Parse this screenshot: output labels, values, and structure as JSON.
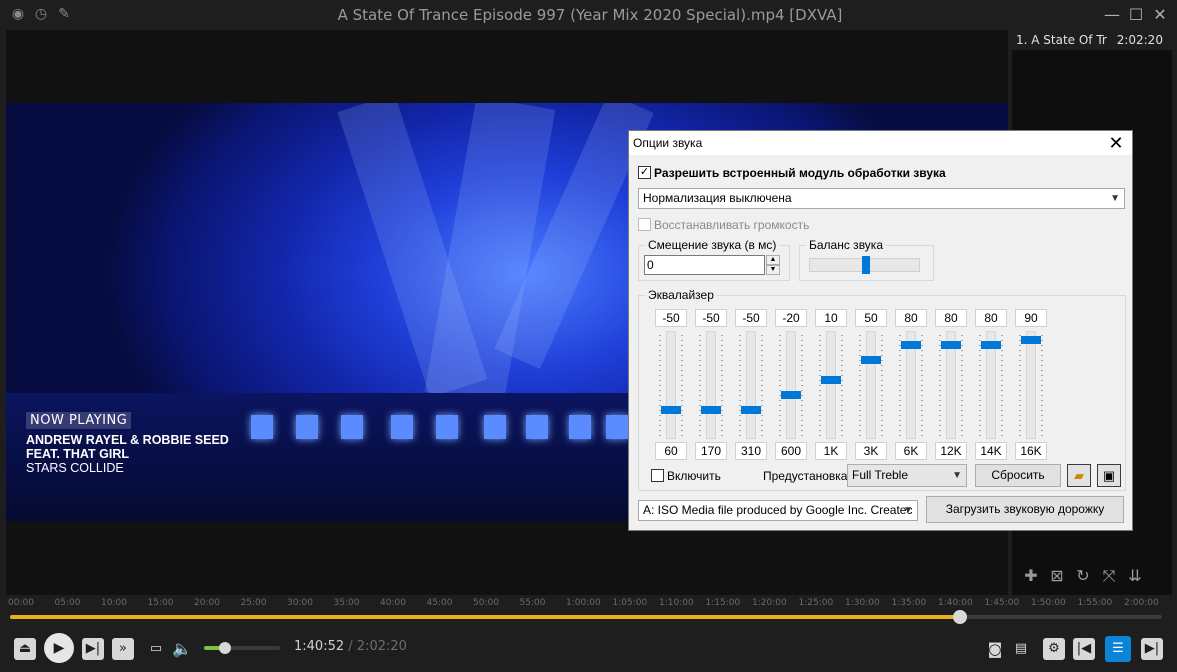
{
  "window": {
    "title": "A State Of Trance Episode 997 (Year Mix 2020 Special).mp4 [DXVA]",
    "left_icons": [
      "menu-circle-icon",
      "clock-icon",
      "pin-icon"
    ],
    "controls": {
      "minimize": "—",
      "maximize": "☐",
      "close": "✕"
    }
  },
  "video": {
    "now_playing_tag": "NOW PLAYING",
    "line1": "ANDREW RAYEL & ROBBIE SEED",
    "line2": "FEAT. THAT GIRL",
    "line3": "STARS COLLIDE"
  },
  "playlist": {
    "items": [
      {
        "label": "1. A State Of Tr",
        "duration": "2:02:20"
      }
    ]
  },
  "timeline": {
    "ticks": [
      "00:00",
      "05:00",
      "10:00",
      "15:00",
      "20:00",
      "25:00",
      "30:00",
      "35:00",
      "40:00",
      "45:00",
      "50:00",
      "55:00",
      "1:00:00",
      "1:05:00",
      "1:10:00",
      "1:15:00",
      "1:20:00",
      "1:25:00",
      "1:30:00",
      "1:35:00",
      "1:40:00",
      "1:45:00",
      "1:50:00",
      "1:55:00",
      "2:00:00"
    ],
    "position_fraction": 0.825
  },
  "player": {
    "current_time": "1:40:52",
    "separator": "/",
    "total_time": "2:02:20",
    "volume_fraction": 0.28
  },
  "dialog": {
    "title": "Опции звука",
    "close": "✕",
    "enable_processing": {
      "label": "Разрешить встроенный модуль обработки звука",
      "checked": true
    },
    "normalization": {
      "value": "Нормализация выключена"
    },
    "restore_volume": {
      "label": "Восстанавливать громкость",
      "checked": false
    },
    "offset_group": {
      "title": "Смещение звука (в мс)",
      "value": "0"
    },
    "balance_group": {
      "title": "Баланс звука",
      "value_fraction": 0.5
    },
    "equalizer": {
      "title": "Эквалайзер",
      "bands": [
        {
          "freq": "60",
          "value": "-50"
        },
        {
          "freq": "170",
          "value": "-50"
        },
        {
          "freq": "310",
          "value": "-50"
        },
        {
          "freq": "600",
          "value": "-20"
        },
        {
          "freq": "1K",
          "value": "10"
        },
        {
          "freq": "3K",
          "value": "50"
        },
        {
          "freq": "6K",
          "value": "80"
        },
        {
          "freq": "12K",
          "value": "80"
        },
        {
          "freq": "14K",
          "value": "80"
        },
        {
          "freq": "16K",
          "value": "90"
        }
      ],
      "enable_label": "Включить",
      "enabled": false,
      "preset_label": "Предустановка",
      "preset_value": "Full Treble",
      "reset_label": "Сбросить"
    },
    "audio_track": {
      "value": "A: ISO Media file produced by Google Inc. Createc"
    },
    "load_track_label": "Загрузить звуковую дорожку"
  },
  "colors": {
    "accent": "#0078d7",
    "seek_fill": "#e8b016",
    "volume_fill": "#7ec243"
  }
}
